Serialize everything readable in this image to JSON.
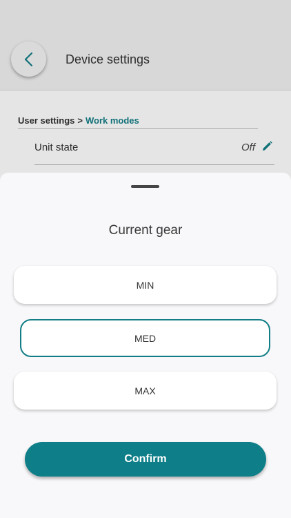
{
  "header": {
    "title": "Device settings",
    "back_icon": "chevron-left-icon"
  },
  "breadcrumb": {
    "parent": "User settings",
    "separator": ">",
    "current": "Work modes"
  },
  "setting": {
    "label": "Unit state",
    "value": "Off",
    "edit_icon": "pencil-icon"
  },
  "sheet": {
    "title": "Current gear",
    "options": [
      {
        "label": "MIN",
        "selected": false
      },
      {
        "label": "MED",
        "selected": true
      },
      {
        "label": "MAX",
        "selected": false
      }
    ],
    "confirm_label": "Confirm"
  },
  "colors": {
    "accent": "#127d86",
    "header_bg": "#f1f1f1",
    "sheet_bg": "#f8f8fa"
  }
}
